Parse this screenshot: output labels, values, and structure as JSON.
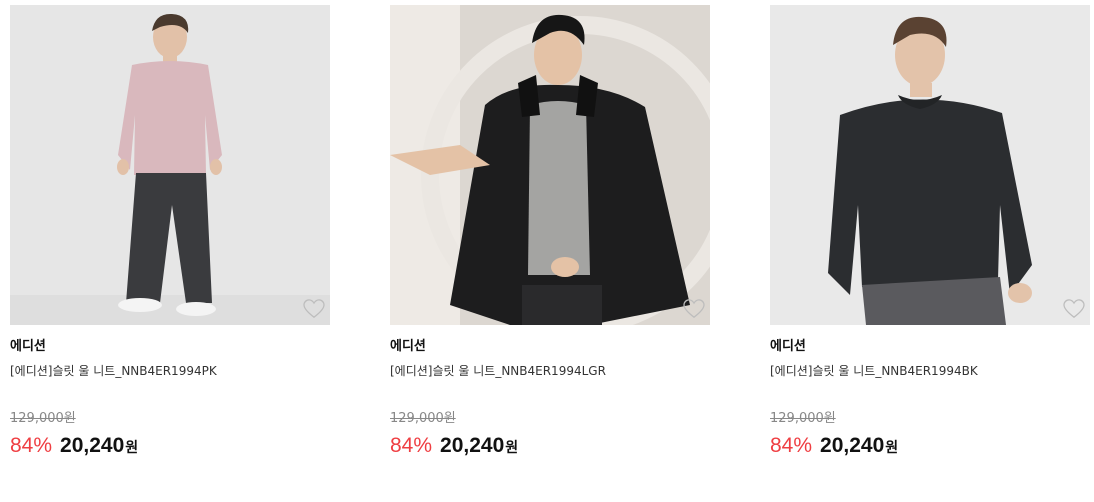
{
  "products": [
    {
      "brand": "에디션",
      "name": "[에디션]슬릿 울 니트_NNB4ER1994PK",
      "original_price": "129,000원",
      "discount": "84%",
      "sale_price": "20,240",
      "currency": "원",
      "image_icon": "model-pink-sweater",
      "colors": {
        "bg": "#e6e6e6",
        "sweater": "#d9b8bd",
        "pants": "#3a3b3e"
      }
    },
    {
      "brand": "에디션",
      "name": "[에디션]슬릿 울 니트_NNB4ER1994LGR",
      "original_price": "129,000원",
      "discount": "84%",
      "sale_price": "20,240",
      "currency": "원",
      "image_icon": "model-black-jacket",
      "colors": {
        "bg": "#dcd7d1",
        "sweater": "#a4a4a2",
        "jacket": "#1d1d1e"
      }
    },
    {
      "brand": "에디션",
      "name": "[에디션]슬릿 울 니트_NNB4ER1994BK",
      "original_price": "129,000원",
      "discount": "84%",
      "sale_price": "20,240",
      "currency": "원",
      "image_icon": "model-black-sweater",
      "colors": {
        "bg": "#e9e9e9",
        "sweater": "#2b2d30",
        "pants": "#5a5a5e"
      }
    }
  ],
  "accent_color": "#ef3e42"
}
